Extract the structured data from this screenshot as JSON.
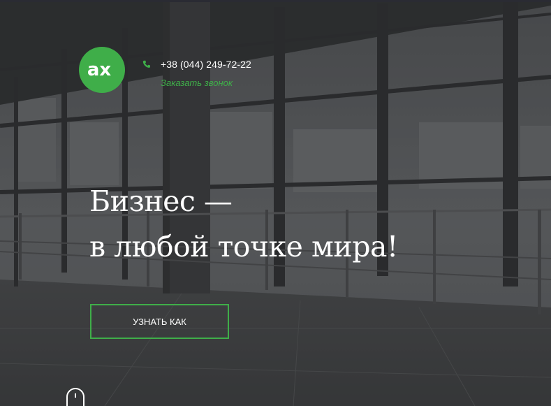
{
  "header": {
    "logo": {
      "glyph_text": "ax",
      "color": "#3fae49"
    },
    "phone": {
      "number": "+38 (044) 249-72-22",
      "icon": "phone-icon"
    },
    "callback_link": "Заказать звонок"
  },
  "hero": {
    "headline_line1": "Бизнес —",
    "headline_line2": "в любой точке мира!",
    "cta_label": "УЗНАТЬ КАК",
    "scroll_icon": "mouse-scroll-icon"
  },
  "colors": {
    "accent": "#3fae49",
    "text": "#ffffff",
    "overlay": "#3a3c3d"
  }
}
